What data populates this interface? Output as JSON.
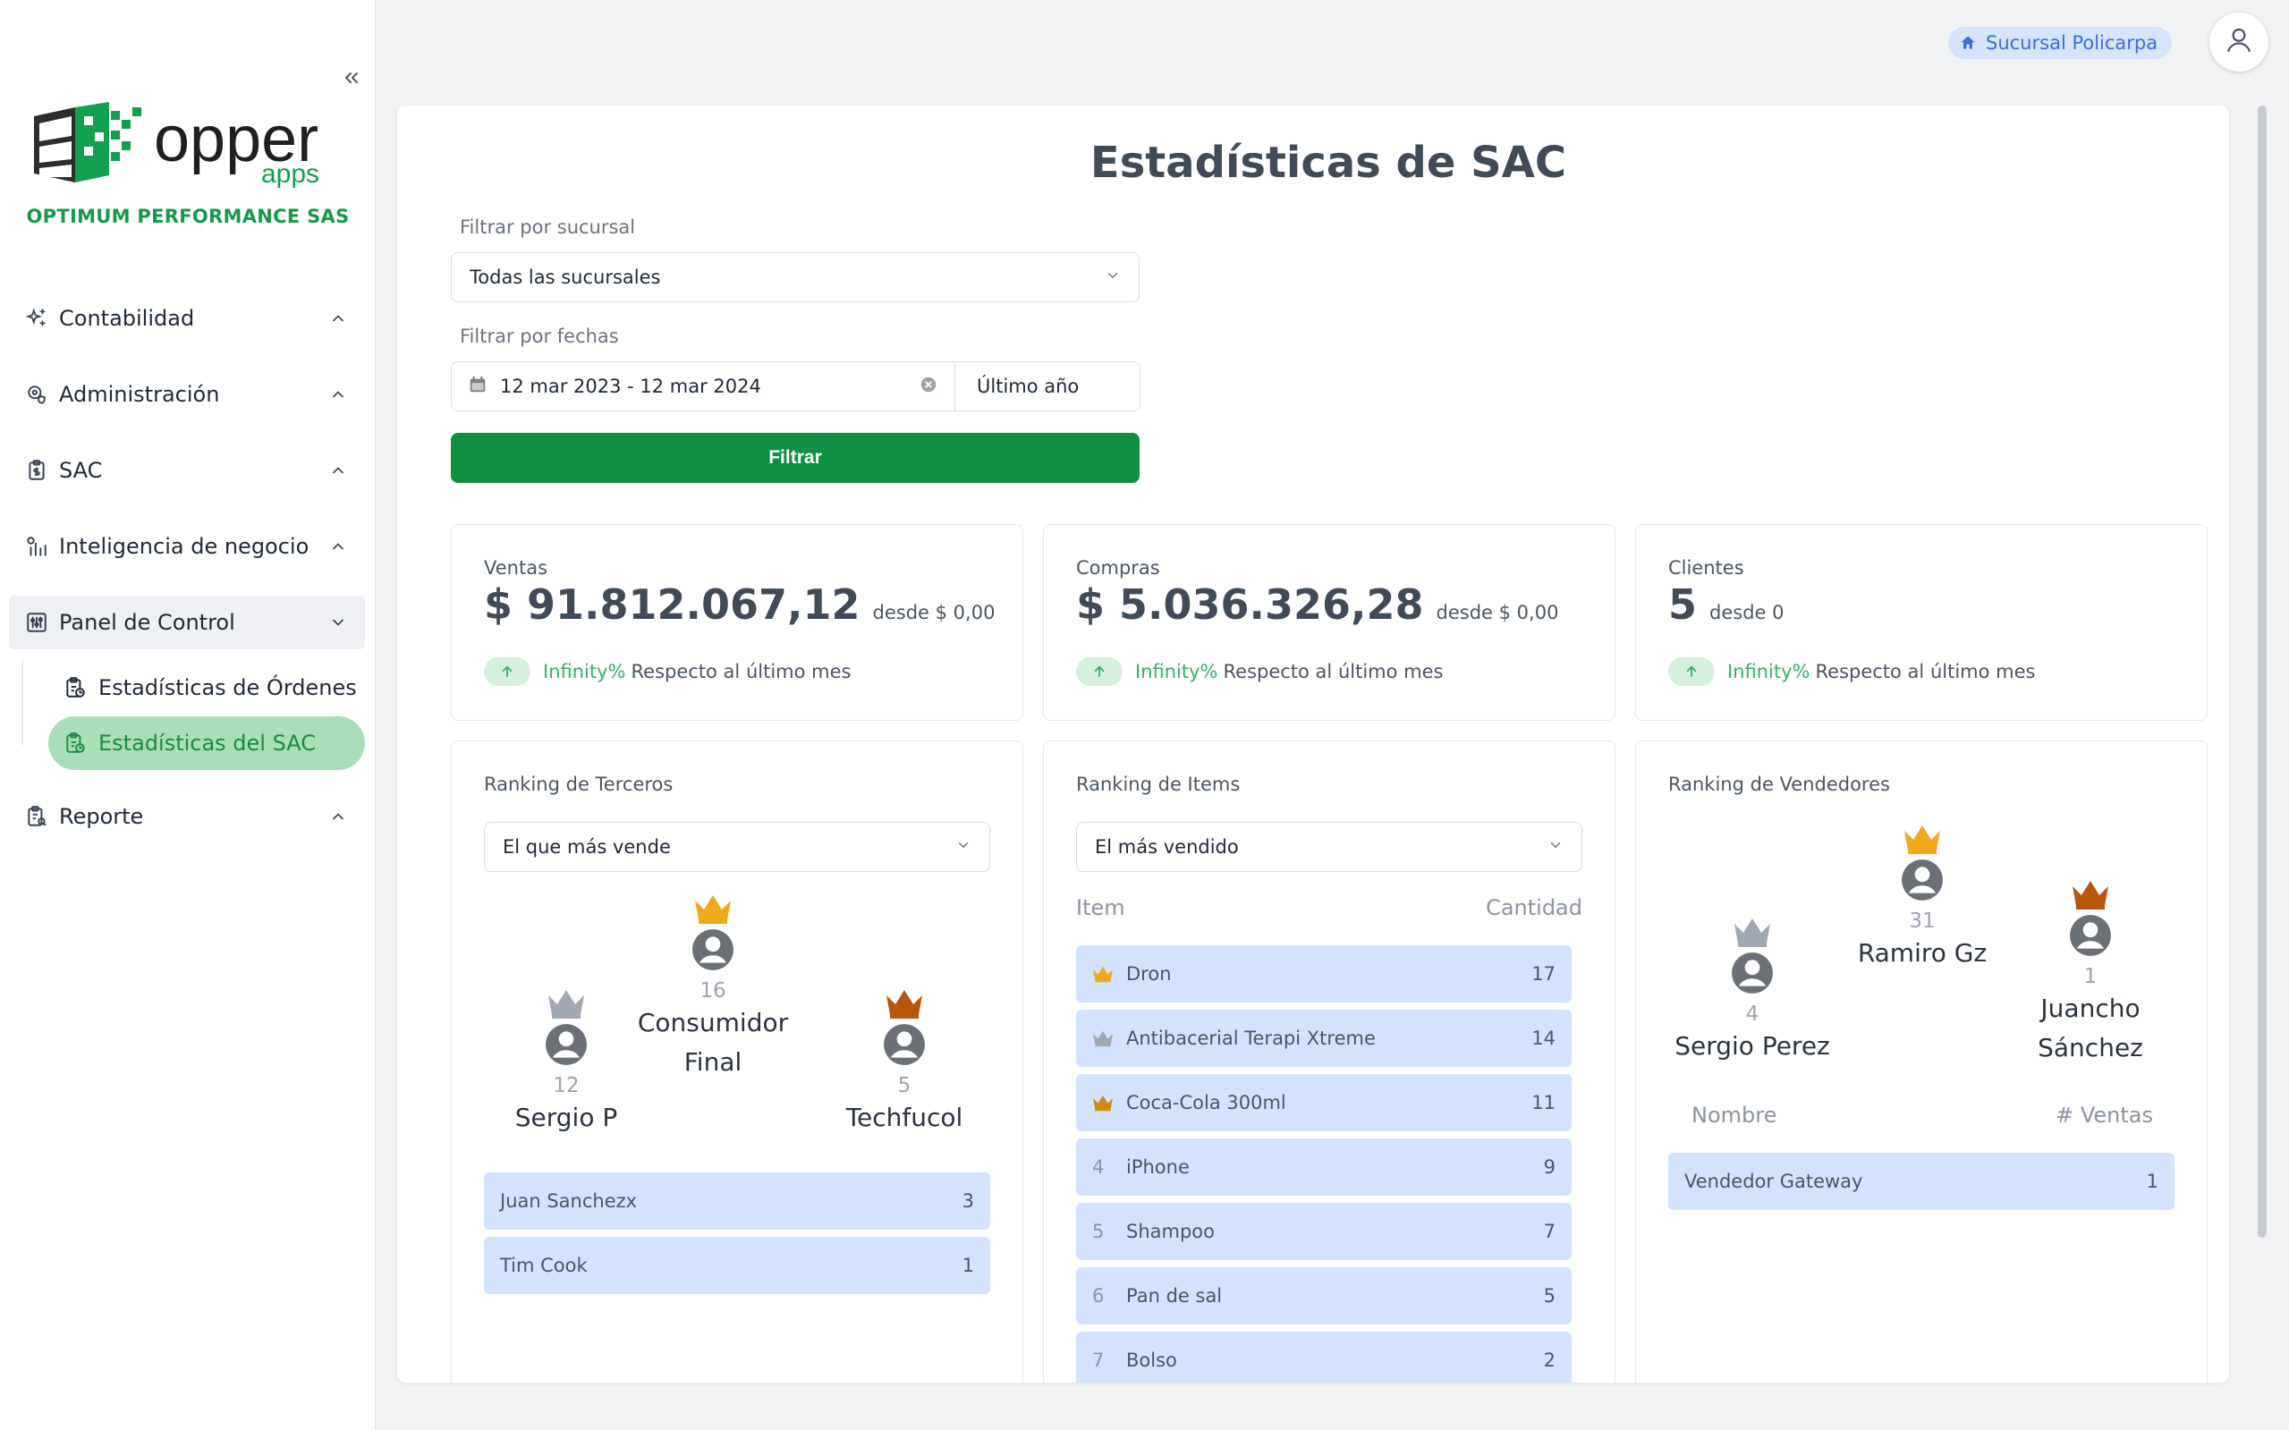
{
  "sidebar": {
    "company": "OPTIMUM PERFORMANCE SAS",
    "logo_text": "opper",
    "logo_sub": "apps",
    "nav": [
      {
        "label": "Contabilidad",
        "icon": "sparkles-icon"
      },
      {
        "label": "Administración",
        "icon": "settings-shield-icon"
      },
      {
        "label": "SAC",
        "icon": "clipboard-dollar-icon"
      },
      {
        "label": "Inteligencia de negocio",
        "icon": "chart-bars-icon"
      },
      {
        "label": "Panel de Control",
        "icon": "sliders-icon"
      },
      {
        "label": "Reporte",
        "icon": "clipboard-search-icon"
      }
    ],
    "panel_sub": [
      {
        "label": "Estadísticas de Órdenes",
        "icon": "clipboard-chart-icon"
      },
      {
        "label": "Estadísticas del SAC",
        "icon": "clipboard-chart-icon"
      }
    ]
  },
  "header": {
    "branch": "Sucursal Policarpa"
  },
  "page": {
    "title": "Estadísticas de SAC",
    "filters": {
      "branch_label": "Filtrar por sucursal",
      "branch_value": "Todas las sucursales",
      "date_label": "Filtrar por fechas",
      "date_value": "12 mar 2023 - 12 mar 2024",
      "preset_value": "Último año",
      "filter_button": "Filtrar"
    },
    "stats": [
      {
        "label": "Ventas",
        "value": "$ 91.812.067,12",
        "since": "desde $ 0,00",
        "trend": "Infinity%",
        "trend_text": "Respecto al último mes"
      },
      {
        "label": "Compras",
        "value": "$ 5.036.326,28",
        "since": "desde $ 0,00",
        "trend": "Infinity%",
        "trend_text": "Respecto al último mes"
      },
      {
        "label": "Clientes",
        "value": "5",
        "since": "desde 0",
        "trend": "Infinity%",
        "trend_text": "Respecto al último mes"
      }
    ],
    "terceros": {
      "title": "Ranking de Terceros",
      "select": "El que más vende",
      "first": {
        "count": "16",
        "name1": "Consumidor",
        "name2": "Final"
      },
      "second": {
        "count": "12",
        "name1": "Sergio P",
        "name2": ""
      },
      "third": {
        "count": "5",
        "name1": "Techfucol",
        "name2": ""
      },
      "rows": [
        {
          "name": "Juan Sanchezx",
          "value": "3"
        },
        {
          "name": "Tim Cook",
          "value": "1"
        }
      ]
    },
    "items": {
      "title": "Ranking de Items",
      "select": "El más vendido",
      "col_item": "Item",
      "col_qty": "Cantidad",
      "rows": [
        {
          "rank": "",
          "name": "Dron",
          "value": "17"
        },
        {
          "rank": "",
          "name": "Antibacerial Terapi Xtreme",
          "value": "14"
        },
        {
          "rank": "",
          "name": "Coca-Cola 300ml",
          "value": "11"
        },
        {
          "rank": "4",
          "name": "iPhone",
          "value": "9"
        },
        {
          "rank": "5",
          "name": "Shampoo",
          "value": "7"
        },
        {
          "rank": "6",
          "name": "Pan de sal",
          "value": "5"
        },
        {
          "rank": "7",
          "name": "Bolso",
          "value": "2"
        }
      ]
    },
    "vendedores": {
      "title": "Ranking de Vendedores",
      "first": {
        "count": "31",
        "name1": "Ramiro Gz",
        "name2": ""
      },
      "second": {
        "count": "4",
        "name1": "Sergio Perez",
        "name2": ""
      },
      "third": {
        "count": "1",
        "name1": "Juancho",
        "name2": "Sánchez"
      },
      "col_name": "Nombre",
      "col_sales": "# Ventas",
      "rows": [
        {
          "name": "Vendedor Gateway",
          "value": "1"
        }
      ]
    }
  },
  "colors": {
    "gold": "#f0a81c",
    "silver": "#a2a8b3",
    "bronze": "#b8560e",
    "brand_green": "#108f43",
    "row_blue": "#d4e3fd"
  }
}
